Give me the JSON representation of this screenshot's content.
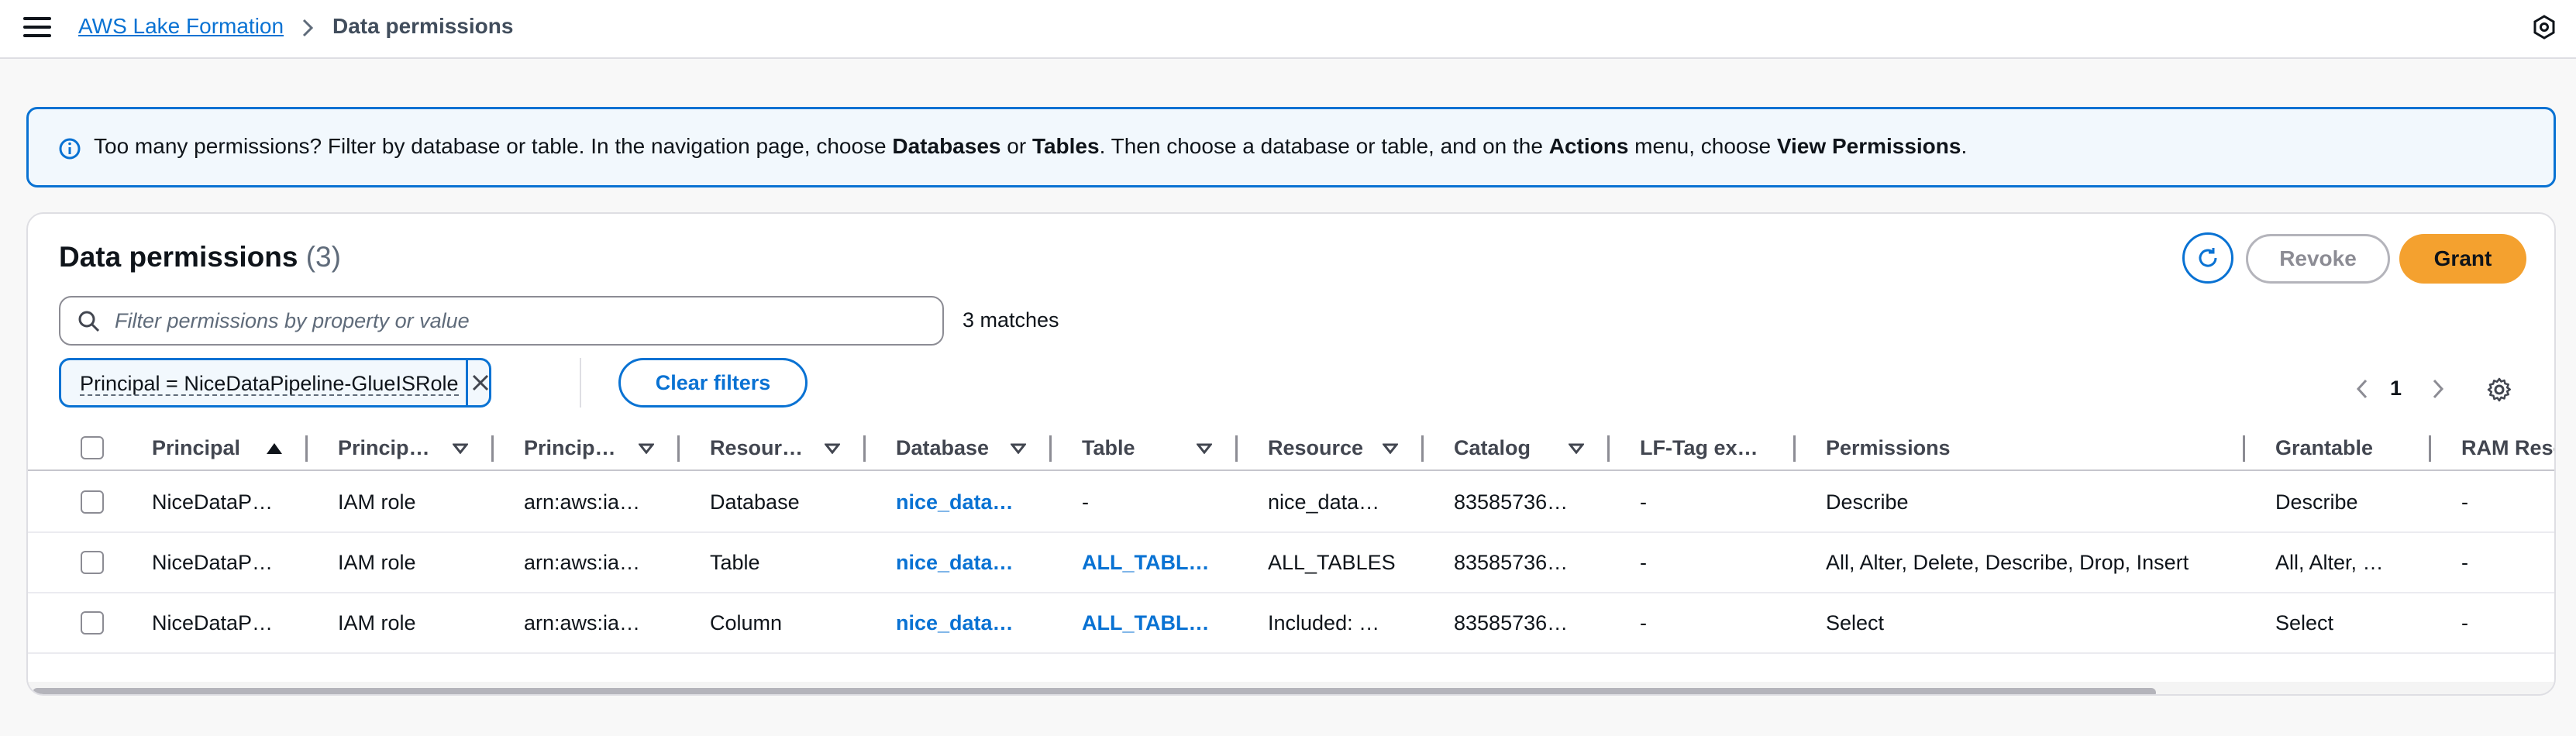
{
  "topbar": {
    "breadcrumb_link": "AWS Lake Formation",
    "breadcrumb_current": "Data permissions",
    "menu_icon": "hamburger-menu-icon",
    "settings_icon": "hexagon-settings-icon"
  },
  "alert": {
    "icon": "info-circle-icon",
    "t1": "Too many permissions? Filter by database or table. In the navigation page, choose ",
    "b1": "Databases",
    "t2": " or ",
    "b2": "Tables",
    "t3": ". Then choose a database or table, and on the ",
    "b3": "Actions",
    "t4": " menu, choose ",
    "b4": "View Permissions",
    "t5": "."
  },
  "header": {
    "title": "Data permissions",
    "count": "(3)",
    "revoke_label": "Revoke",
    "grant_label": "Grant",
    "refresh_icon": "refresh-icon"
  },
  "filter": {
    "placeholder": "Filter permissions by property or value",
    "value": "",
    "matches": "3 matches",
    "token": "Principal = NiceDataPipeline-GlueISRole",
    "clear_label": "Clear filters"
  },
  "pagination": {
    "current_page": "1"
  },
  "table": {
    "columns": [
      "Principal",
      "Princip…",
      "Princip…",
      "Resour…",
      "Database",
      "Table",
      "Resource",
      "Catalog",
      "LF-Tag ex…",
      "Permissions",
      "Grantable",
      "RAM Reso"
    ],
    "sort_column": "Principal",
    "sort_direction": "ascending",
    "rows": [
      {
        "principal": "NiceDataP…",
        "principal_type": "IAM role",
        "principal_arn": "arn:aws:ia…",
        "resource_type": "Database",
        "database": "nice_data…",
        "table": "-",
        "resource": "nice_data…",
        "catalog": "83585736…",
        "lf_tag": "-",
        "permissions": "Describe",
        "grantable": "Describe",
        "ram": "-"
      },
      {
        "principal": "NiceDataP…",
        "principal_type": "IAM role",
        "principal_arn": "arn:aws:ia…",
        "resource_type": "Table",
        "database": "nice_data…",
        "table": "ALL_TABL…",
        "resource": "ALL_TABLES",
        "catalog": "83585736…",
        "lf_tag": "-",
        "permissions": "All, Alter, Delete, Describe, Drop, Insert",
        "grantable": "All, Alter, …",
        "ram": "-"
      },
      {
        "principal": "NiceDataP…",
        "principal_type": "IAM role",
        "principal_arn": "arn:aws:ia…",
        "resource_type": "Column",
        "database": "nice_data…",
        "table": "ALL_TABL…",
        "resource": "Included: …",
        "catalog": "83585736…",
        "lf_tag": "-",
        "permissions": "Select",
        "grantable": "Select",
        "ram": "-"
      }
    ]
  },
  "colors": {
    "link": "#0972d3",
    "grant_button": "#f4a12f",
    "alert_bg": "#f2f8fd"
  }
}
